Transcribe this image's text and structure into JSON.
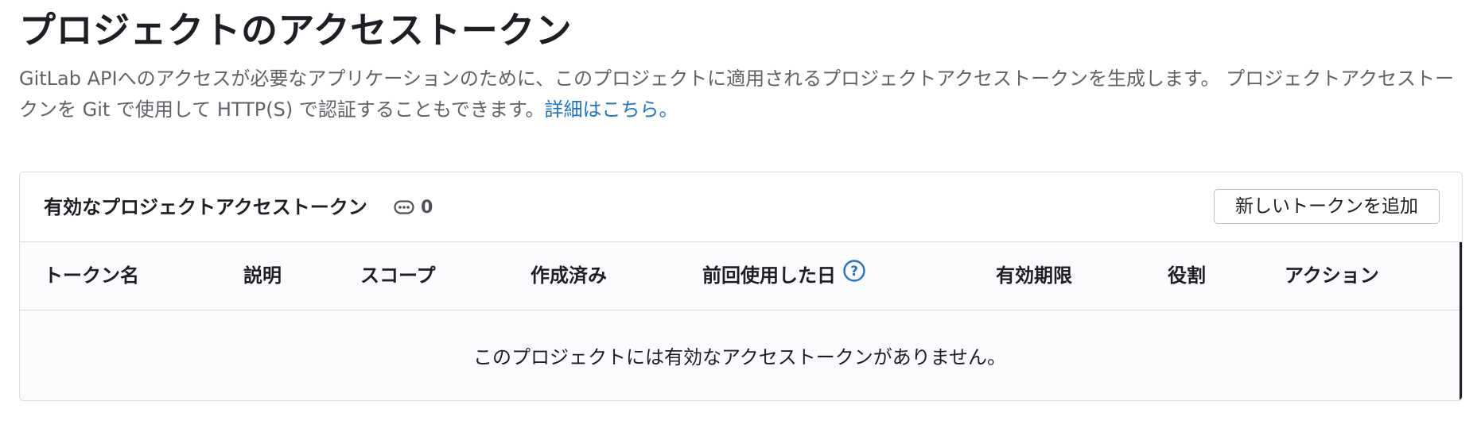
{
  "page": {
    "title": "プロジェクトのアクセストークン",
    "description": "GitLab APIへのアクセスが必要なアプリケーションのために、このプロジェクトに適用されるプロジェクトアクセストークンを生成します。 プロジェクトアクセストークンを Git で使用して HTTP(S) で認証することもできます。",
    "learn_more_link": "詳細はこちら。"
  },
  "card": {
    "title": "有効なプロジェクトアクセストークン",
    "count": "0",
    "add_button_label": "新しいトークンを追加"
  },
  "table": {
    "columns": [
      "トークン名",
      "説明",
      "スコープ",
      "作成済み",
      "前回使用した日",
      "有効期限",
      "役割",
      "アクション"
    ],
    "empty_message": "このプロジェクトには有効なアクセストークンがありません。"
  },
  "colors": {
    "link": "#1f75cb",
    "text": "#1f1e24",
    "muted_text": "#626168",
    "border": "#dcdcde",
    "table_bg": "#fbfafd"
  },
  "icons": {
    "count_badge": "token-icon",
    "last_used_help": "question-circle-icon"
  }
}
